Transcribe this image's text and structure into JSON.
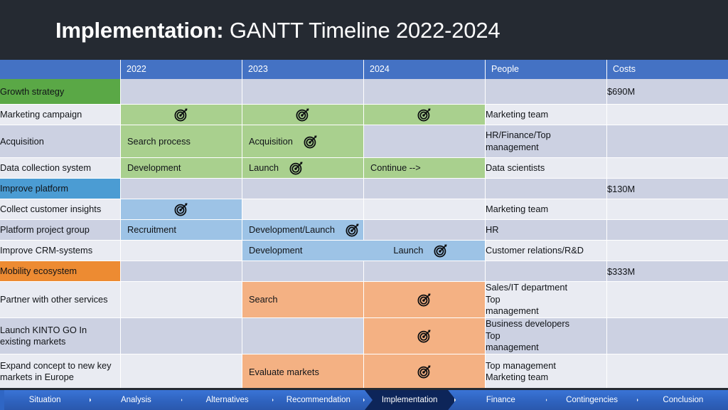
{
  "title": {
    "strong": "Implementation:",
    "light": " GANTT Timeline 2022-2024"
  },
  "colors": {
    "header_blue": "#4472c4",
    "cat_green": "#5aa846",
    "cat_blue": "#4b9cd3",
    "cat_orange": "#ed8b32",
    "bar_green": "#a9d08e",
    "bar_blue": "#9dc3e6",
    "bar_orange": "#f4b183",
    "row_dark": "#ccd1e2",
    "row_light": "#e9ebf2",
    "slide_bg": "#252a32",
    "nav_blue": "#2f66c4",
    "nav_active": "#0d2559"
  },
  "table": {
    "columns": [
      "",
      "2022",
      "2023",
      "2024",
      "People",
      "Costs"
    ],
    "rows": [
      {
        "task": "Growth strategy",
        "kind": "category",
        "accent": "green",
        "stripe": "dark",
        "bars": [],
        "people": "",
        "cost": "$690M"
      },
      {
        "task": "Marketing campaign",
        "kind": "task",
        "stripe": "light",
        "bars": [
          {
            "start": 0,
            "span": 1,
            "color": "green",
            "label": "",
            "icon": "target-icon",
            "icon_pos": "center"
          },
          {
            "start": 1,
            "span": 1,
            "color": "green",
            "label": "",
            "icon": "target-icon",
            "icon_pos": "center"
          },
          {
            "start": 2,
            "span": 1,
            "color": "green",
            "label": "",
            "icon": "target-icon",
            "icon_pos": "center"
          }
        ],
        "people": "Marketing team",
        "cost": ""
      },
      {
        "task": "Acquisition",
        "kind": "task",
        "stripe": "dark",
        "bars": [
          {
            "start": 0,
            "span": 1,
            "color": "green",
            "label": "Search process",
            "icon": "",
            "icon_pos": ""
          },
          {
            "start": 1,
            "span": 1,
            "color": "green",
            "label": "Acquisition",
            "icon": "target-icon",
            "icon_pos": "after"
          }
        ],
        "people": "HR/Finance/Top management",
        "cost": ""
      },
      {
        "task": "Data collection system",
        "kind": "task",
        "stripe": "light",
        "bars": [
          {
            "start": 0,
            "span": 1,
            "color": "green",
            "label": "Development",
            "icon": "",
            "icon_pos": ""
          },
          {
            "start": 1,
            "span": 1,
            "color": "green",
            "label": "Launch",
            "icon": "target-icon",
            "icon_pos": "after"
          },
          {
            "start": 2,
            "span": 1,
            "color": "green",
            "label": "Continue -->",
            "icon": "",
            "icon_pos": ""
          }
        ],
        "people": "Data scientists",
        "cost": ""
      },
      {
        "task": "Improve platform",
        "kind": "category",
        "accent": "blue",
        "stripe": "dark",
        "bars": [],
        "people": "",
        "cost": "$130M"
      },
      {
        "task": "Collect customer insights",
        "kind": "task",
        "stripe": "light",
        "bars": [
          {
            "start": 0,
            "span": 1,
            "color": "blue",
            "label": "",
            "icon": "target-icon",
            "icon_pos": "center"
          }
        ],
        "people": "Marketing team",
        "cost": ""
      },
      {
        "task": "Platform project group",
        "kind": "task",
        "stripe": "dark",
        "bars": [
          {
            "start": 0,
            "span": 1,
            "color": "blue",
            "label": "Recruitment",
            "icon": "",
            "icon_pos": ""
          },
          {
            "start": 1,
            "span": 1,
            "color": "blue",
            "label": "Development/Launch",
            "icon": "target-icon",
            "icon_pos": "after"
          }
        ],
        "people": "HR",
        "cost": ""
      },
      {
        "task": "Improve CRM-systems",
        "kind": "task",
        "stripe": "light",
        "bars": [
          {
            "start": 1,
            "span": 2,
            "color": "blue",
            "label": "Development",
            "icon": "target-icon",
            "icon_pos": "split",
            "label2": "Launch"
          }
        ],
        "people": "Customer relations/R&D",
        "cost": ""
      },
      {
        "task": "Mobility ecosystem",
        "kind": "category",
        "accent": "orange",
        "stripe": "dark",
        "bars": [],
        "people": "",
        "cost": "$333M"
      },
      {
        "task": "Partner with other services",
        "kind": "task",
        "stripe": "light",
        "bars": [
          {
            "start": 1,
            "span": 1,
            "color": "orange",
            "label": "Search",
            "icon": "",
            "icon_pos": ""
          },
          {
            "start": 2,
            "span": 1,
            "color": "orange",
            "label": "",
            "icon": "target-icon",
            "icon_pos": "center"
          }
        ],
        "people": "Sales/IT department Top management",
        "cost": ""
      },
      {
        "task": "Launch KINTO GO In existing markets",
        "kind": "task",
        "stripe": "dark",
        "bars": [
          {
            "start": 2,
            "span": 1,
            "color": "orange",
            "label": "",
            "icon": "target-icon",
            "icon_pos": "center"
          }
        ],
        "people": "Business developers Top management",
        "cost": ""
      },
      {
        "task": "Expand concept to new key markets in Europe",
        "kind": "task",
        "stripe": "light",
        "bars": [
          {
            "start": 1,
            "span": 1,
            "color": "orange",
            "label": "Evaluate markets",
            "icon": "",
            "icon_pos": ""
          },
          {
            "start": 2,
            "span": 1,
            "color": "orange",
            "label": "",
            "icon": "target-icon",
            "icon_pos": "center"
          }
        ],
        "people": "Top management Marketing team",
        "cost": ""
      }
    ]
  },
  "nav": {
    "items": [
      {
        "label": "Situation",
        "active": false
      },
      {
        "label": "Analysis",
        "active": false
      },
      {
        "label": "Alternatives",
        "active": false
      },
      {
        "label": "Recommendation",
        "active": false
      },
      {
        "label": "Implementation",
        "active": true
      },
      {
        "label": "Finance",
        "active": false
      },
      {
        "label": "Contingencies",
        "active": false
      },
      {
        "label": "Conclusion",
        "active": false
      }
    ]
  }
}
